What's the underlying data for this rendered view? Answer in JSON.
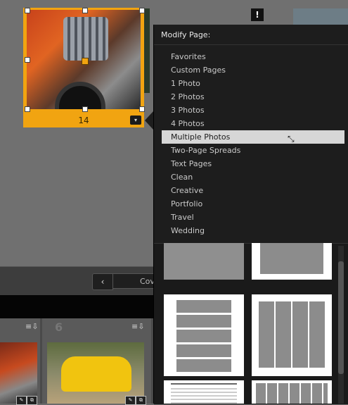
{
  "canvas": {
    "selected_page_number": "14",
    "warning_icon_text": "!",
    "accent_color": "#f1a411"
  },
  "toolbar": {
    "prev_label": "‹",
    "cover_label": "Cov"
  },
  "filmstrip": {
    "second_number": "6"
  },
  "menu": {
    "title": "Modify Page:",
    "items": [
      {
        "label": "Favorites"
      },
      {
        "label": "Custom Pages"
      },
      {
        "label": "1 Photo"
      },
      {
        "label": "2 Photos"
      },
      {
        "label": "3 Photos"
      },
      {
        "label": "4 Photos"
      },
      {
        "label": "Multiple Photos",
        "highlighted": true
      },
      {
        "label": "Two-Page Spreads"
      },
      {
        "label": "Text Pages"
      },
      {
        "label": "Clean"
      },
      {
        "label": "Creative"
      },
      {
        "label": "Portfolio"
      },
      {
        "label": "Travel"
      },
      {
        "label": "Wedding"
      }
    ]
  }
}
